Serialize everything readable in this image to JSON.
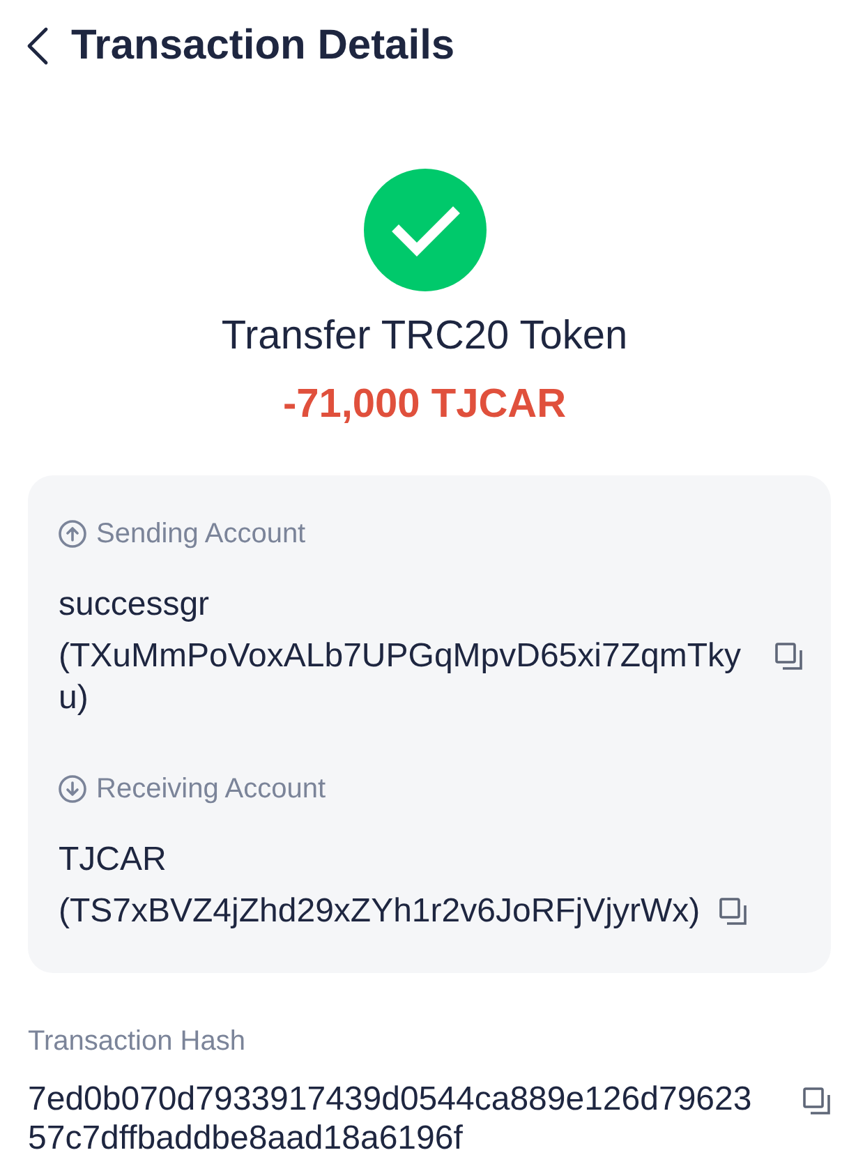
{
  "header": {
    "title": "Transaction Details"
  },
  "status": {
    "kind": "success"
  },
  "summary": {
    "type": "Transfer TRC20 Token",
    "amount": "-71,000 TJCAR"
  },
  "accounts": [
    {
      "kind": "sending",
      "label": "Sending Account",
      "name": "successgr",
      "address": "(TXuMmPoVoxALb7UPGqMpvD65xi7ZqmTkyu)"
    },
    {
      "kind": "receiving",
      "label": "Receiving Account",
      "name": "TJCAR",
      "address": "(TS7xBVZ4jZhd29xZYh1r2v6JoRFjVjyrWx)"
    }
  ],
  "hash": {
    "label": "Transaction Hash",
    "value": "7ed0b070d7933917439d0544ca889e126d7962357c7dffbaddbe8aad18a6196f"
  }
}
